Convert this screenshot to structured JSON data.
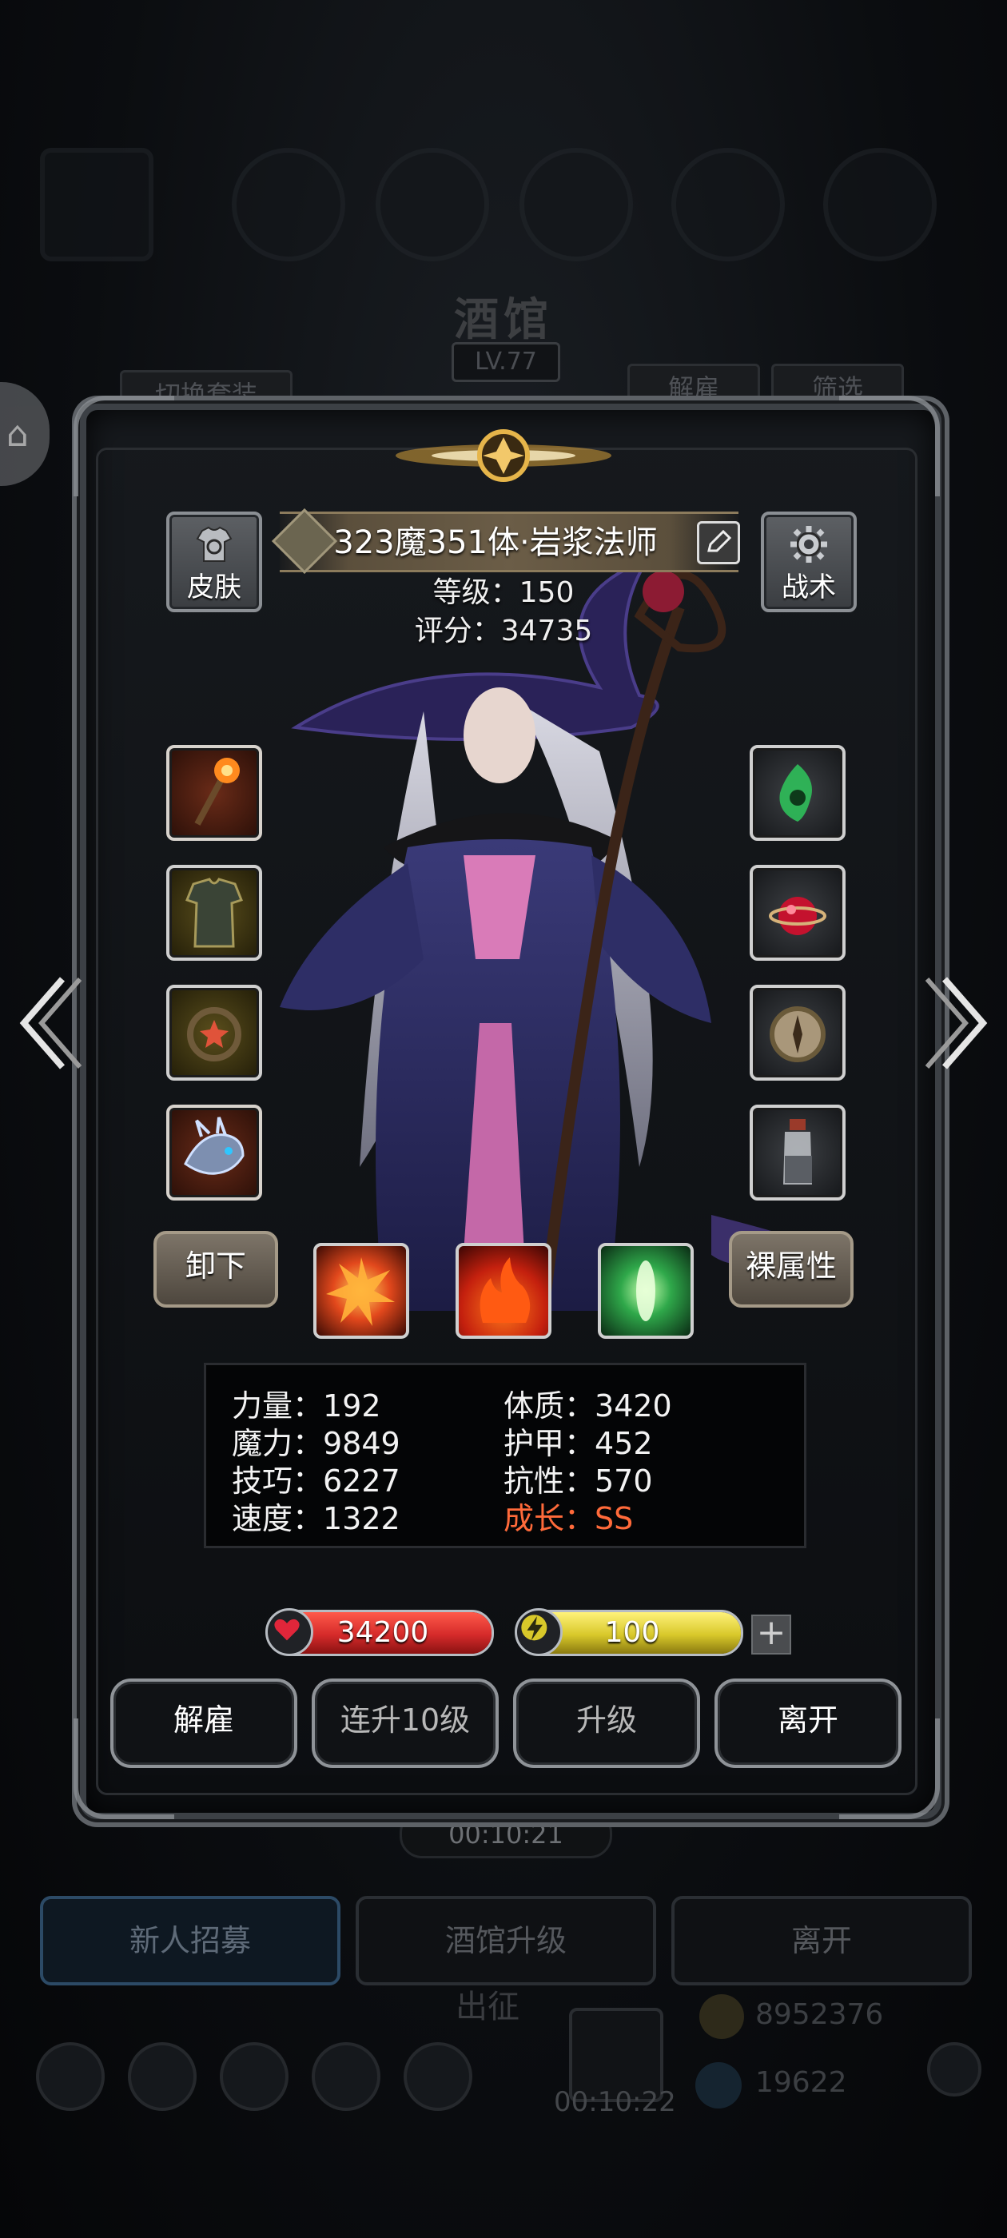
{
  "background": {
    "title": "酒馆",
    "level": "LV.77",
    "switch_outfit_label": "切换套装",
    "dismiss_label": "解雇",
    "filter_label": "筛选",
    "timer": "00:10:21",
    "bottom_buttons": [
      "新人招募",
      "酒馆升级",
      "离开"
    ],
    "sortie_label": "出征",
    "sortie_timer": "00:10:22",
    "gold": "8952376",
    "gems": "19622"
  },
  "header": {
    "skin_label": "皮肤",
    "tactics_label": "战术",
    "hero_name": "323魔351体·岩浆法师",
    "level_line": "等级：150",
    "score_line": "评分：34735"
  },
  "equipment": {
    "left": [
      {
        "name": "staff",
        "icon": "fire-staff-icon",
        "frame": "orange"
      },
      {
        "name": "robe",
        "icon": "robe-icon",
        "frame": "gold"
      },
      {
        "name": "ring",
        "icon": "ring-icon",
        "frame": "gold"
      },
      {
        "name": "pet",
        "icon": "dragon-icon",
        "frame": "orange"
      }
    ],
    "right": [
      {
        "name": "amulet",
        "icon": "green-flame-icon",
        "frame": "grey"
      },
      {
        "name": "gem",
        "icon": "red-orb-icon",
        "frame": "grey"
      },
      {
        "name": "compass",
        "icon": "compass-icon",
        "frame": "grey"
      },
      {
        "name": "potion",
        "icon": "potion-bottle-icon",
        "frame": "grey"
      }
    ]
  },
  "actions_row": {
    "unequip_label": "卸下",
    "base_attr_label": "裸属性",
    "skills": [
      "fire-burst-icon",
      "flame-icon",
      "green-light-icon"
    ]
  },
  "attributes": {
    "strength": "力量：192",
    "constitution": "体质：3420",
    "magic": "魔力：9849",
    "armor": "护甲：452",
    "skill": "技巧：6227",
    "resistance": "抗性：570",
    "speed": "速度：1322",
    "growth": "成长：SS"
  },
  "resources": {
    "hp": "34200",
    "energy": "100",
    "hp_fill": 1.0,
    "energy_fill": 1.0,
    "plus_label": "+"
  },
  "buttons": {
    "dismiss": "解雇",
    "level_up_10": "连升10级",
    "level_up": "升级",
    "leave": "离开"
  },
  "colors": {
    "hp": "#d52a2a",
    "energy": "#d8c82a",
    "growth": "#ff6a3a"
  }
}
